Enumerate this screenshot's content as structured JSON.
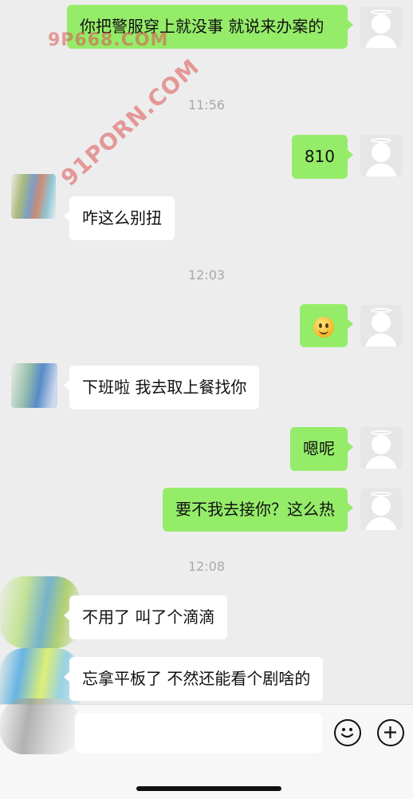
{
  "watermarks": [
    "9P668.COM",
    "91PORN.COM"
  ],
  "times": [
    "11:56",
    "12:03",
    "12:08"
  ],
  "messages": [
    {
      "side": "me",
      "text": "你把警服穿上就没事 就说来办案的"
    },
    {
      "side": "me",
      "text": "810"
    },
    {
      "side": "them",
      "text": "咋这么别扭"
    },
    {
      "side": "me",
      "text": "",
      "icon": "smile-emoji-icon"
    },
    {
      "side": "them",
      "text": "下班啦 我去取上餐找你"
    },
    {
      "side": "me",
      "text": "嗯呢"
    },
    {
      "side": "me",
      "text": "要不我去接你？这么热"
    },
    {
      "side": "them",
      "text": "不用了 叫了个滴滴"
    },
    {
      "side": "them",
      "text": "忘拿平板了 不然还能看个剧啥的"
    }
  ],
  "input": {
    "value": "",
    "emoji_icon": "emoji-icon",
    "plus_icon": "plus-icon"
  },
  "colors": {
    "me_bubble": "#95ec69",
    "them_bubble": "#ffffff",
    "background": "#ededed",
    "timestamp": "#a8a8a8"
  }
}
